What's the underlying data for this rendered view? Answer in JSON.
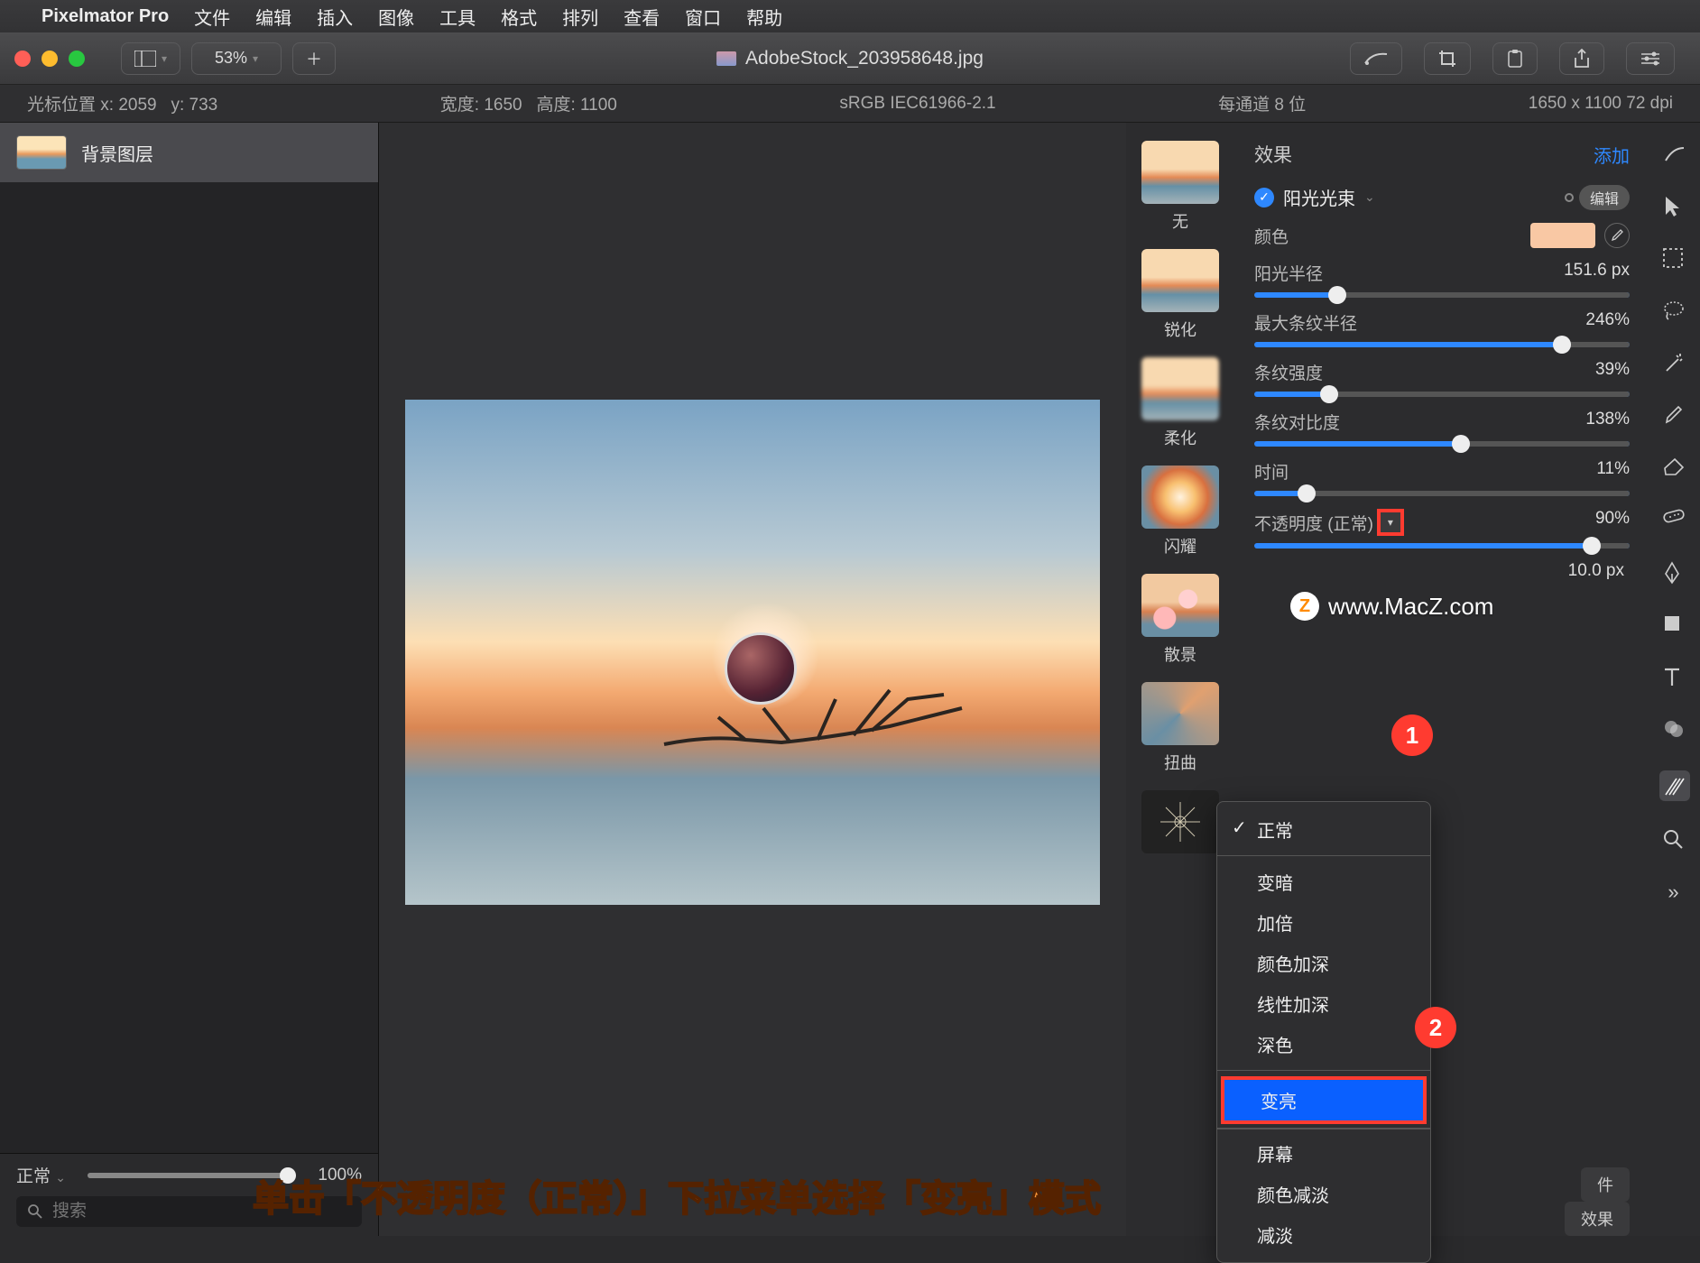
{
  "menubar": {
    "app_name": "Pixelmator Pro",
    "items": [
      "文件",
      "编辑",
      "插入",
      "图像",
      "工具",
      "格式",
      "排列",
      "查看",
      "窗口",
      "帮助"
    ]
  },
  "toolbar": {
    "zoom": "53%",
    "title": "AdobeStock_203958648.jpg"
  },
  "infobar": {
    "cursor_label": "光标位置 x:",
    "cursor_x": "2059",
    "cursor_y_label": "y:",
    "cursor_y": "733",
    "width_label": "宽度:",
    "width": "1650",
    "height_label": "高度:",
    "height": "1100",
    "color_profile": "sRGB IEC61966-2.1",
    "bits": "每通道 8 位",
    "dims_dpi": "1650 x 1100 72 dpi"
  },
  "layers": {
    "item_name": "背景图层",
    "blend_mode": "正常",
    "opacity_value": "100%",
    "search_placeholder": "搜索"
  },
  "presets": {
    "items": [
      "无",
      "锐化",
      "柔化",
      "闪耀",
      "散景",
      "扭曲",
      ""
    ]
  },
  "inspector": {
    "title": "效果",
    "add": "添加",
    "effect_name": "阳光光束",
    "edit": "编辑",
    "color_label": "颜色",
    "color_hex": "#f9c8a4",
    "params": [
      {
        "label": "阳光半径",
        "value": "151.6 px",
        "pct": 22
      },
      {
        "label": "最大条纹半径",
        "value": "246%",
        "pct": 82
      },
      {
        "label": "条纹强度",
        "value": "39%",
        "pct": 20
      },
      {
        "label": "条纹对比度",
        "value": "138%",
        "pct": 55
      },
      {
        "label": "时间",
        "value": "11%",
        "pct": 14
      }
    ],
    "opacity_label": "不透明度 (正常)",
    "opacity_value": "90%",
    "opacity_pct": 90,
    "extra_value": "10.0 px",
    "original": "件",
    "effect_seg": "效果"
  },
  "dropdown": {
    "checked": "正常",
    "group1": [
      "变暗",
      "加倍",
      "颜色加深",
      "线性加深",
      "深色"
    ],
    "highlight": "变亮",
    "group2": [
      "屏幕",
      "颜色减淡",
      "   减淡"
    ]
  },
  "badges": {
    "one": "1",
    "two": "2"
  },
  "watermark": {
    "logo": "Z",
    "text": "www.MacZ.com"
  },
  "caption": "单击「不透明度（正常）」下拉菜单选择「变亮」模式"
}
